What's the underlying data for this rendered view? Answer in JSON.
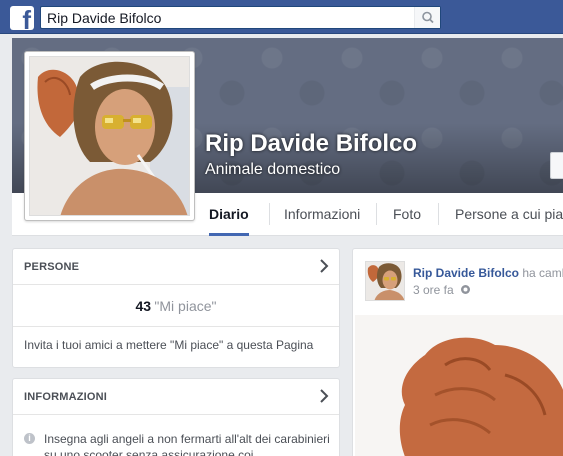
{
  "search": {
    "value": "Rip Davide Bifolco"
  },
  "icons": {
    "logo": "facebook-f-logo",
    "search": "magnifier-icon",
    "chevron": "chevron-right-icon",
    "info": "info-circle-icon",
    "privacy": "globe-icon"
  },
  "colors": {
    "brand": "#3b5998",
    "link": "#365899",
    "tab_active_underline": "#4267b2"
  },
  "page": {
    "name": "Rip Davide Bifolco",
    "category": "Animale domestico"
  },
  "tabs": [
    {
      "label": "Diario",
      "active": true
    },
    {
      "label": "Informazioni",
      "active": false
    },
    {
      "label": "Foto",
      "active": false
    },
    {
      "label": "Persone a cui piace",
      "active": false
    }
  ],
  "people_card": {
    "title": "PERSONE",
    "likes_count": "43",
    "likes_label": "\"Mi piace\"",
    "invite_text": "Invita i tuoi amici a mettere \"Mi piace\" a questa Pagina"
  },
  "info_card": {
    "title": "INFORMAZIONI",
    "text": "Insegna agli angeli a non fermarti all'alt dei carabinieri su uno scooter senza assicurazione coi"
  },
  "post": {
    "author": "Rip Davide Bifolco",
    "action": "ha cambiato",
    "time": "3 ore fa"
  }
}
